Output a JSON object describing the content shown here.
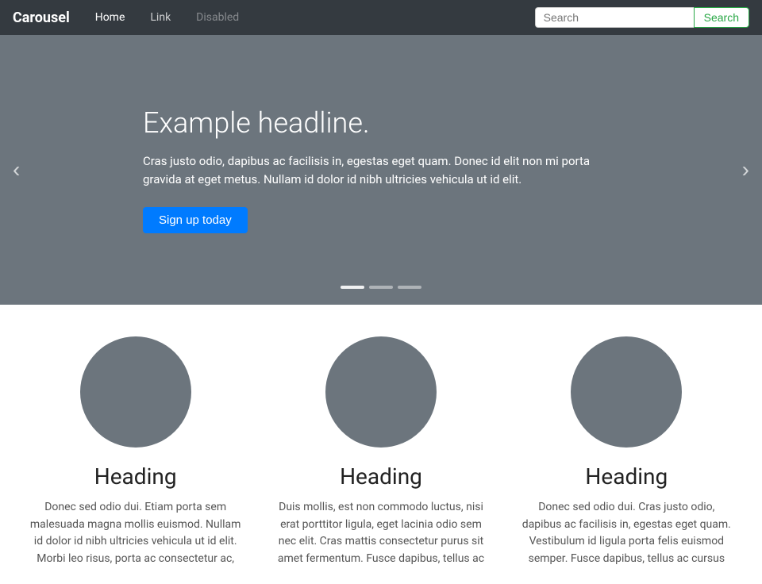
{
  "navbar": {
    "brand": "Carousel",
    "links": [
      {
        "label": "Home",
        "state": "active"
      },
      {
        "label": "Link",
        "state": "normal"
      },
      {
        "label": "Disabled",
        "state": "disabled"
      }
    ],
    "search": {
      "placeholder": "Search",
      "button_label": "Search"
    }
  },
  "carousel": {
    "slide": {
      "headline": "Example headline.",
      "body": "Cras justo odio, dapibus ac facilisis in, egestas eget quam. Donec id elit non mi porta gravida at eget metus. Nullam id dolor id nibh ultricies vehicula ut id elit.",
      "cta_label": "Sign up today"
    },
    "prev_label": "‹",
    "next_label": "›",
    "indicators": [
      {
        "state": "active"
      },
      {
        "state": "inactive"
      },
      {
        "state": "inactive"
      }
    ]
  },
  "features": [
    {
      "heading": "Heading",
      "body": "Donec sed odio dui. Etiam porta sem malesuada magna mollis euismod. Nullam id dolor id nibh ultricies vehicula ut id elit. Morbi leo risus, porta ac consectetur ac,"
    },
    {
      "heading": "Heading",
      "body": "Duis mollis, est non commodo luctus, nisi erat porttitor ligula, eget lacinia odio sem nec elit. Cras mattis consectetur purus sit amet fermentum. Fusce dapibus, tellus ac"
    },
    {
      "heading": "Heading",
      "body": "Donec sed odio dui. Cras justo odio, dapibus ac facilisis in, egestas eget quam. Vestibulum id ligula porta felis euismod semper. Fusce dapibus, tellus ac cursus"
    }
  ]
}
